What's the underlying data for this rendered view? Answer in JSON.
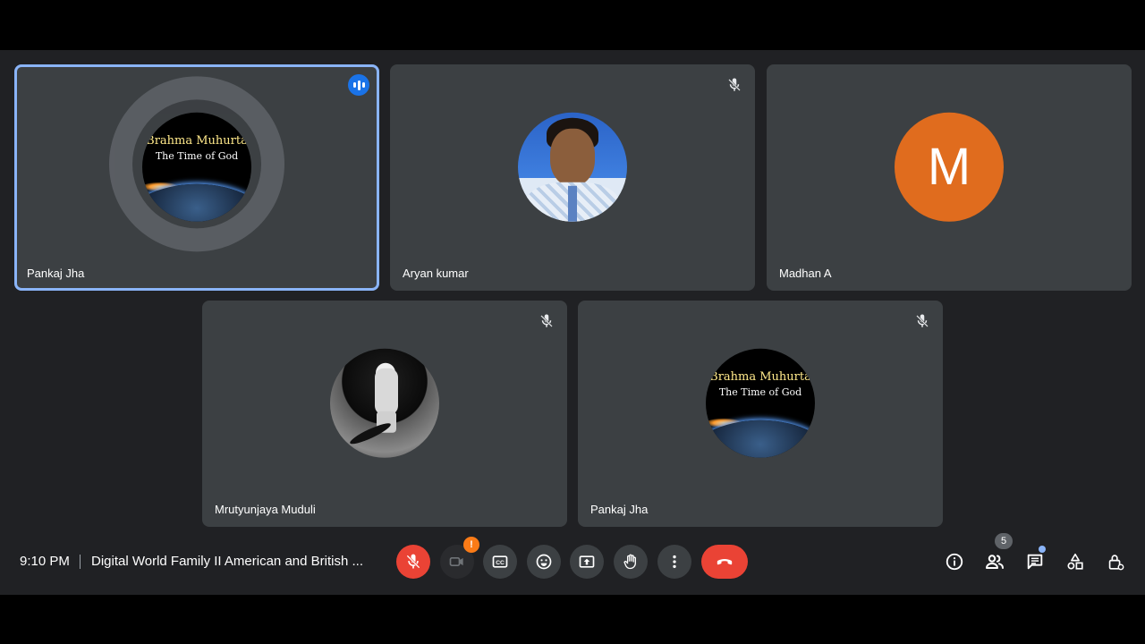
{
  "participants": [
    {
      "name": "Pankaj Jha",
      "speaking": true,
      "avatar": "brahma-muhurta"
    },
    {
      "name": "Aryan kumar",
      "muted": true,
      "avatar": "photo-boy"
    },
    {
      "name": "Madhan A",
      "muted": false,
      "avatar": "letter",
      "letter": "M",
      "color": "#e06c1e"
    },
    {
      "name": "Mrutyunjaya Muduli",
      "muted": true,
      "avatar": "photo-astronaut"
    },
    {
      "name": "Pankaj Jha",
      "muted": true,
      "avatar": "brahma-muhurta"
    }
  ],
  "avatar_text": {
    "title": "Brahma Muhurta",
    "subtitle": "The Time of God"
  },
  "bar": {
    "time": "9:10 PM",
    "meeting_title": "Digital World Family II American and British ...",
    "camera_alert": "!",
    "people_count": "5"
  },
  "colors": {
    "accent": "#8ab4f8",
    "danger": "#ea4335",
    "tile_bg": "#3c4043",
    "stage_bg": "#202124",
    "warning": "#fa7b17"
  },
  "icons": {
    "mic": "mic-off-icon",
    "camera": "camera-off-icon",
    "captions": "captions-icon",
    "emoji": "emoji-icon",
    "present": "present-icon",
    "hand": "raise-hand-icon",
    "more": "more-vert-icon",
    "hangup": "call-end-icon",
    "info": "info-icon",
    "people": "people-icon",
    "chat": "chat-icon",
    "activities": "activities-icon",
    "host": "host-controls-icon"
  }
}
